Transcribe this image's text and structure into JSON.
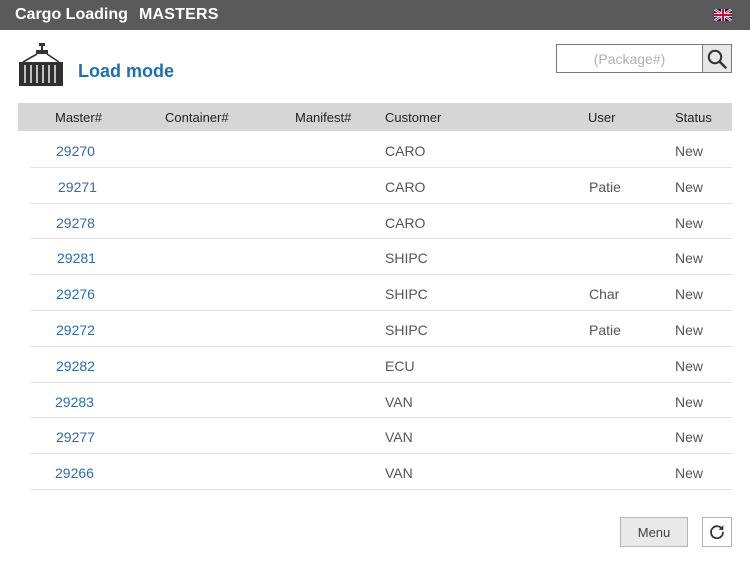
{
  "topbar": {
    "app_title": "Cargo Loading",
    "section_title": "MASTERS",
    "language_icon": "uk-flag-icon"
  },
  "header": {
    "icon": "crane-container-icon",
    "title": "Load mode"
  },
  "search": {
    "placeholder": "(Package#)",
    "value": "",
    "icon": "search-icon"
  },
  "table": {
    "columns": [
      "Master#",
      "Container#",
      "Manifest#",
      "Customer",
      "User",
      "Status"
    ],
    "rows": [
      {
        "master": "29270",
        "container": "",
        "manifest": "",
        "customer": "CARO",
        "user": "",
        "status": "New"
      },
      {
        "master": "29271",
        "container": "",
        "manifest": "",
        "customer": "CARO",
        "user": "Patie",
        "status": "New"
      },
      {
        "master": "29278",
        "container": "",
        "manifest": "",
        "customer": "CARO",
        "user": "",
        "status": "New"
      },
      {
        "master": "29281",
        "container": "",
        "manifest": "",
        "customer": "SHIPC",
        "user": "",
        "status": "New"
      },
      {
        "master": "29276",
        "container": "",
        "manifest": "",
        "customer": "SHIPC",
        "user": "Char",
        "status": "New"
      },
      {
        "master": "29272",
        "container": "",
        "manifest": "",
        "customer": "SHIPC",
        "user": "Patie",
        "status": "New"
      },
      {
        "master": "29282",
        "container": "",
        "manifest": "",
        "customer": "ECU",
        "user": "",
        "status": "New"
      },
      {
        "master": "29283",
        "container": "",
        "manifest": "",
        "customer": "VAN",
        "user": "",
        "status": "New"
      },
      {
        "master": "29277",
        "container": "",
        "manifest": "",
        "customer": "VAN",
        "user": "",
        "status": "New"
      },
      {
        "master": "29266",
        "container": "",
        "manifest": "",
        "customer": "VAN",
        "user": "",
        "status": "New"
      }
    ]
  },
  "footer": {
    "menu_label": "Menu",
    "refresh_icon": "refresh-icon"
  },
  "colors": {
    "topbar_bg": "#5a5a5a",
    "accent": "#1f6fb2",
    "link": "#2b6cb0",
    "table_header_bg": "#d6d6d6"
  }
}
